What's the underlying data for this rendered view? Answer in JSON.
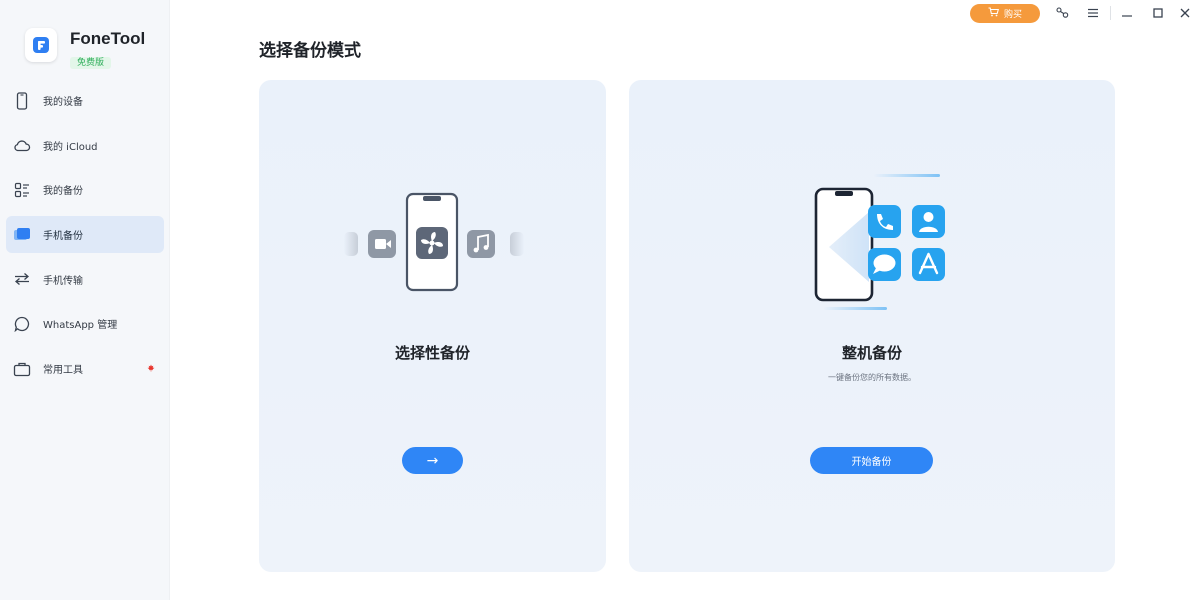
{
  "app": {
    "name": "FoneTool",
    "edition_badge": "免费版"
  },
  "sidebar": {
    "items": [
      {
        "label": "我的设备",
        "icon": "phone-icon"
      },
      {
        "label": "我的 iCloud",
        "icon": "cloud-icon"
      },
      {
        "label": "我的备份",
        "icon": "backup-list-icon"
      },
      {
        "label": "手机备份",
        "icon": "phone-backup-icon",
        "active": true
      },
      {
        "label": "手机传输",
        "icon": "transfer-icon"
      },
      {
        "label": "WhatsApp 管理",
        "icon": "chat-bubble-icon"
      },
      {
        "label": "常用工具",
        "icon": "toolbox-icon",
        "badge_icon": "maple-leaf-icon"
      }
    ]
  },
  "titlebar": {
    "buy_label": "购买",
    "icons": [
      "cart-icon",
      "key-icon",
      "menu-icon",
      "minimize-icon",
      "maximize-icon",
      "close-icon"
    ]
  },
  "main": {
    "title": "选择备份模式",
    "cards": [
      {
        "title": "选择性备份",
        "description": "",
        "button": "→"
      },
      {
        "title": "整机备份",
        "description": "一键备份您的所有数据。",
        "button": "开始备份"
      }
    ]
  },
  "colors": {
    "accent": "#2f86f6",
    "buy": "#f59a3c",
    "active_nav_bg": "#dfe9f8",
    "card_bg": "#eaf1fa",
    "badge_green": "#2fae5b"
  }
}
